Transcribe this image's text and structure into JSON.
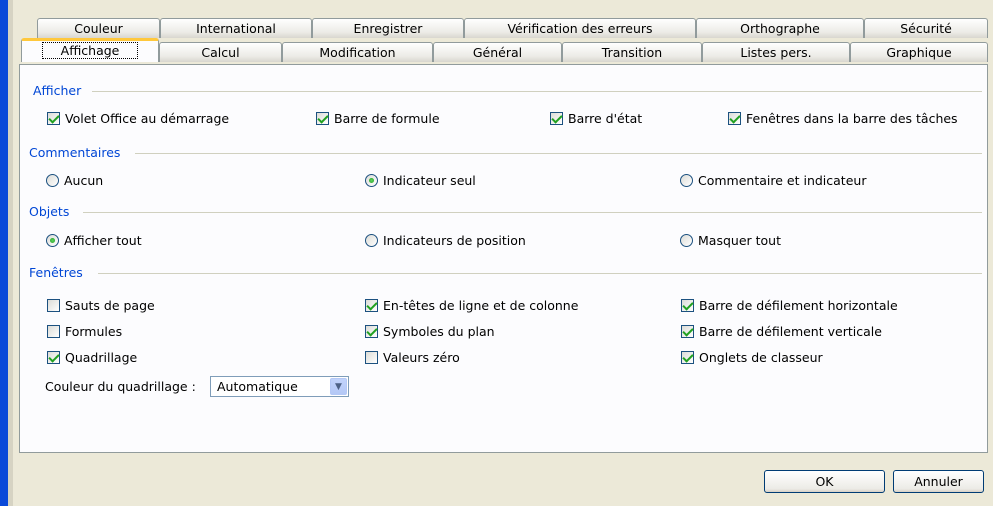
{
  "tabs_back": [
    "Couleur",
    "International",
    "Enregistrer",
    "Vérification des erreurs",
    "Orthographe",
    "Sécurité"
  ],
  "tabs_front": [
    "Affichage",
    "Calcul",
    "Modification",
    "Général",
    "Transition",
    "Listes pers.",
    "Graphique"
  ],
  "groups": {
    "afficher": {
      "title": "Afficher",
      "items": [
        {
          "label": "Volet Office au démarrage",
          "checked": true
        },
        {
          "label": "Barre de formule",
          "checked": true
        },
        {
          "label": "Barre d'état",
          "checked": true
        },
        {
          "label": "Fenêtres dans la barre des tâches",
          "checked": true
        }
      ]
    },
    "commentaires": {
      "title": "Commentaires",
      "items": [
        {
          "label": "Aucun",
          "selected": false
        },
        {
          "label": "Indicateur seul",
          "selected": true
        },
        {
          "label": "Commentaire et indicateur",
          "selected": false
        }
      ]
    },
    "objets": {
      "title": "Objets",
      "items": [
        {
          "label": "Afficher tout",
          "selected": true
        },
        {
          "label": "Indicateurs de position",
          "selected": false
        },
        {
          "label": "Masquer tout",
          "selected": false
        }
      ]
    },
    "fenetres": {
      "title": "Fenêtres",
      "items": [
        {
          "label": "Sauts de page",
          "checked": false
        },
        {
          "label": "En-têtes de ligne et de colonne",
          "checked": true
        },
        {
          "label": "Barre de défilement horizontale",
          "checked": true
        },
        {
          "label": "Formules",
          "checked": false
        },
        {
          "label": "Symboles du plan",
          "checked": true
        },
        {
          "label": "Barre de défilement verticale",
          "checked": true
        },
        {
          "label": "Quadrillage",
          "checked": true
        },
        {
          "label": "Valeurs zéro",
          "checked": false
        },
        {
          "label": "Onglets de classeur",
          "checked": true
        }
      ],
      "gridcolor_label": "Couleur du quadrillage :",
      "gridcolor_value": "Automatique"
    }
  },
  "buttons": {
    "ok": "OK",
    "cancel": "Annuler"
  },
  "colors": {
    "group_title": "#0046d5",
    "active_tab_accent": "#ffc83c",
    "check": "#21a121"
  }
}
